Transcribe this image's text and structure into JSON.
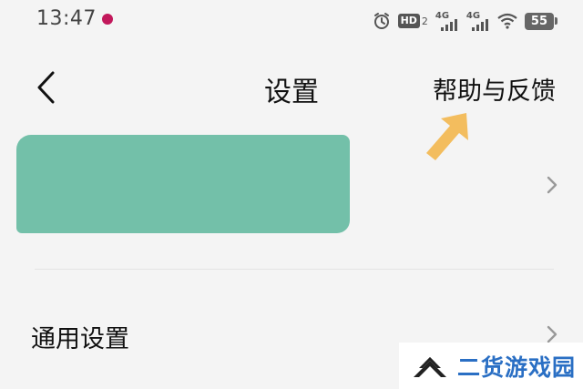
{
  "status_bar": {
    "time": "13:47",
    "hd_label": "HD",
    "hd_sub": "2",
    "network_1": "4G",
    "network_2": "4G",
    "battery": "55"
  },
  "nav": {
    "title": "设置",
    "help_link": "帮助与反馈"
  },
  "rows": {
    "general_settings": "通用设置"
  },
  "watermark": {
    "text": "二货游戏园"
  },
  "colors": {
    "account_card": "#73c0a9",
    "arrow": "#f3bd5e",
    "watermark_text": "#2a6fc4"
  },
  "icons": {
    "back": "chevron-left-icon",
    "row": "chevron-right-icon",
    "alarm": "alarm-icon",
    "wifi": "wifi-icon"
  }
}
